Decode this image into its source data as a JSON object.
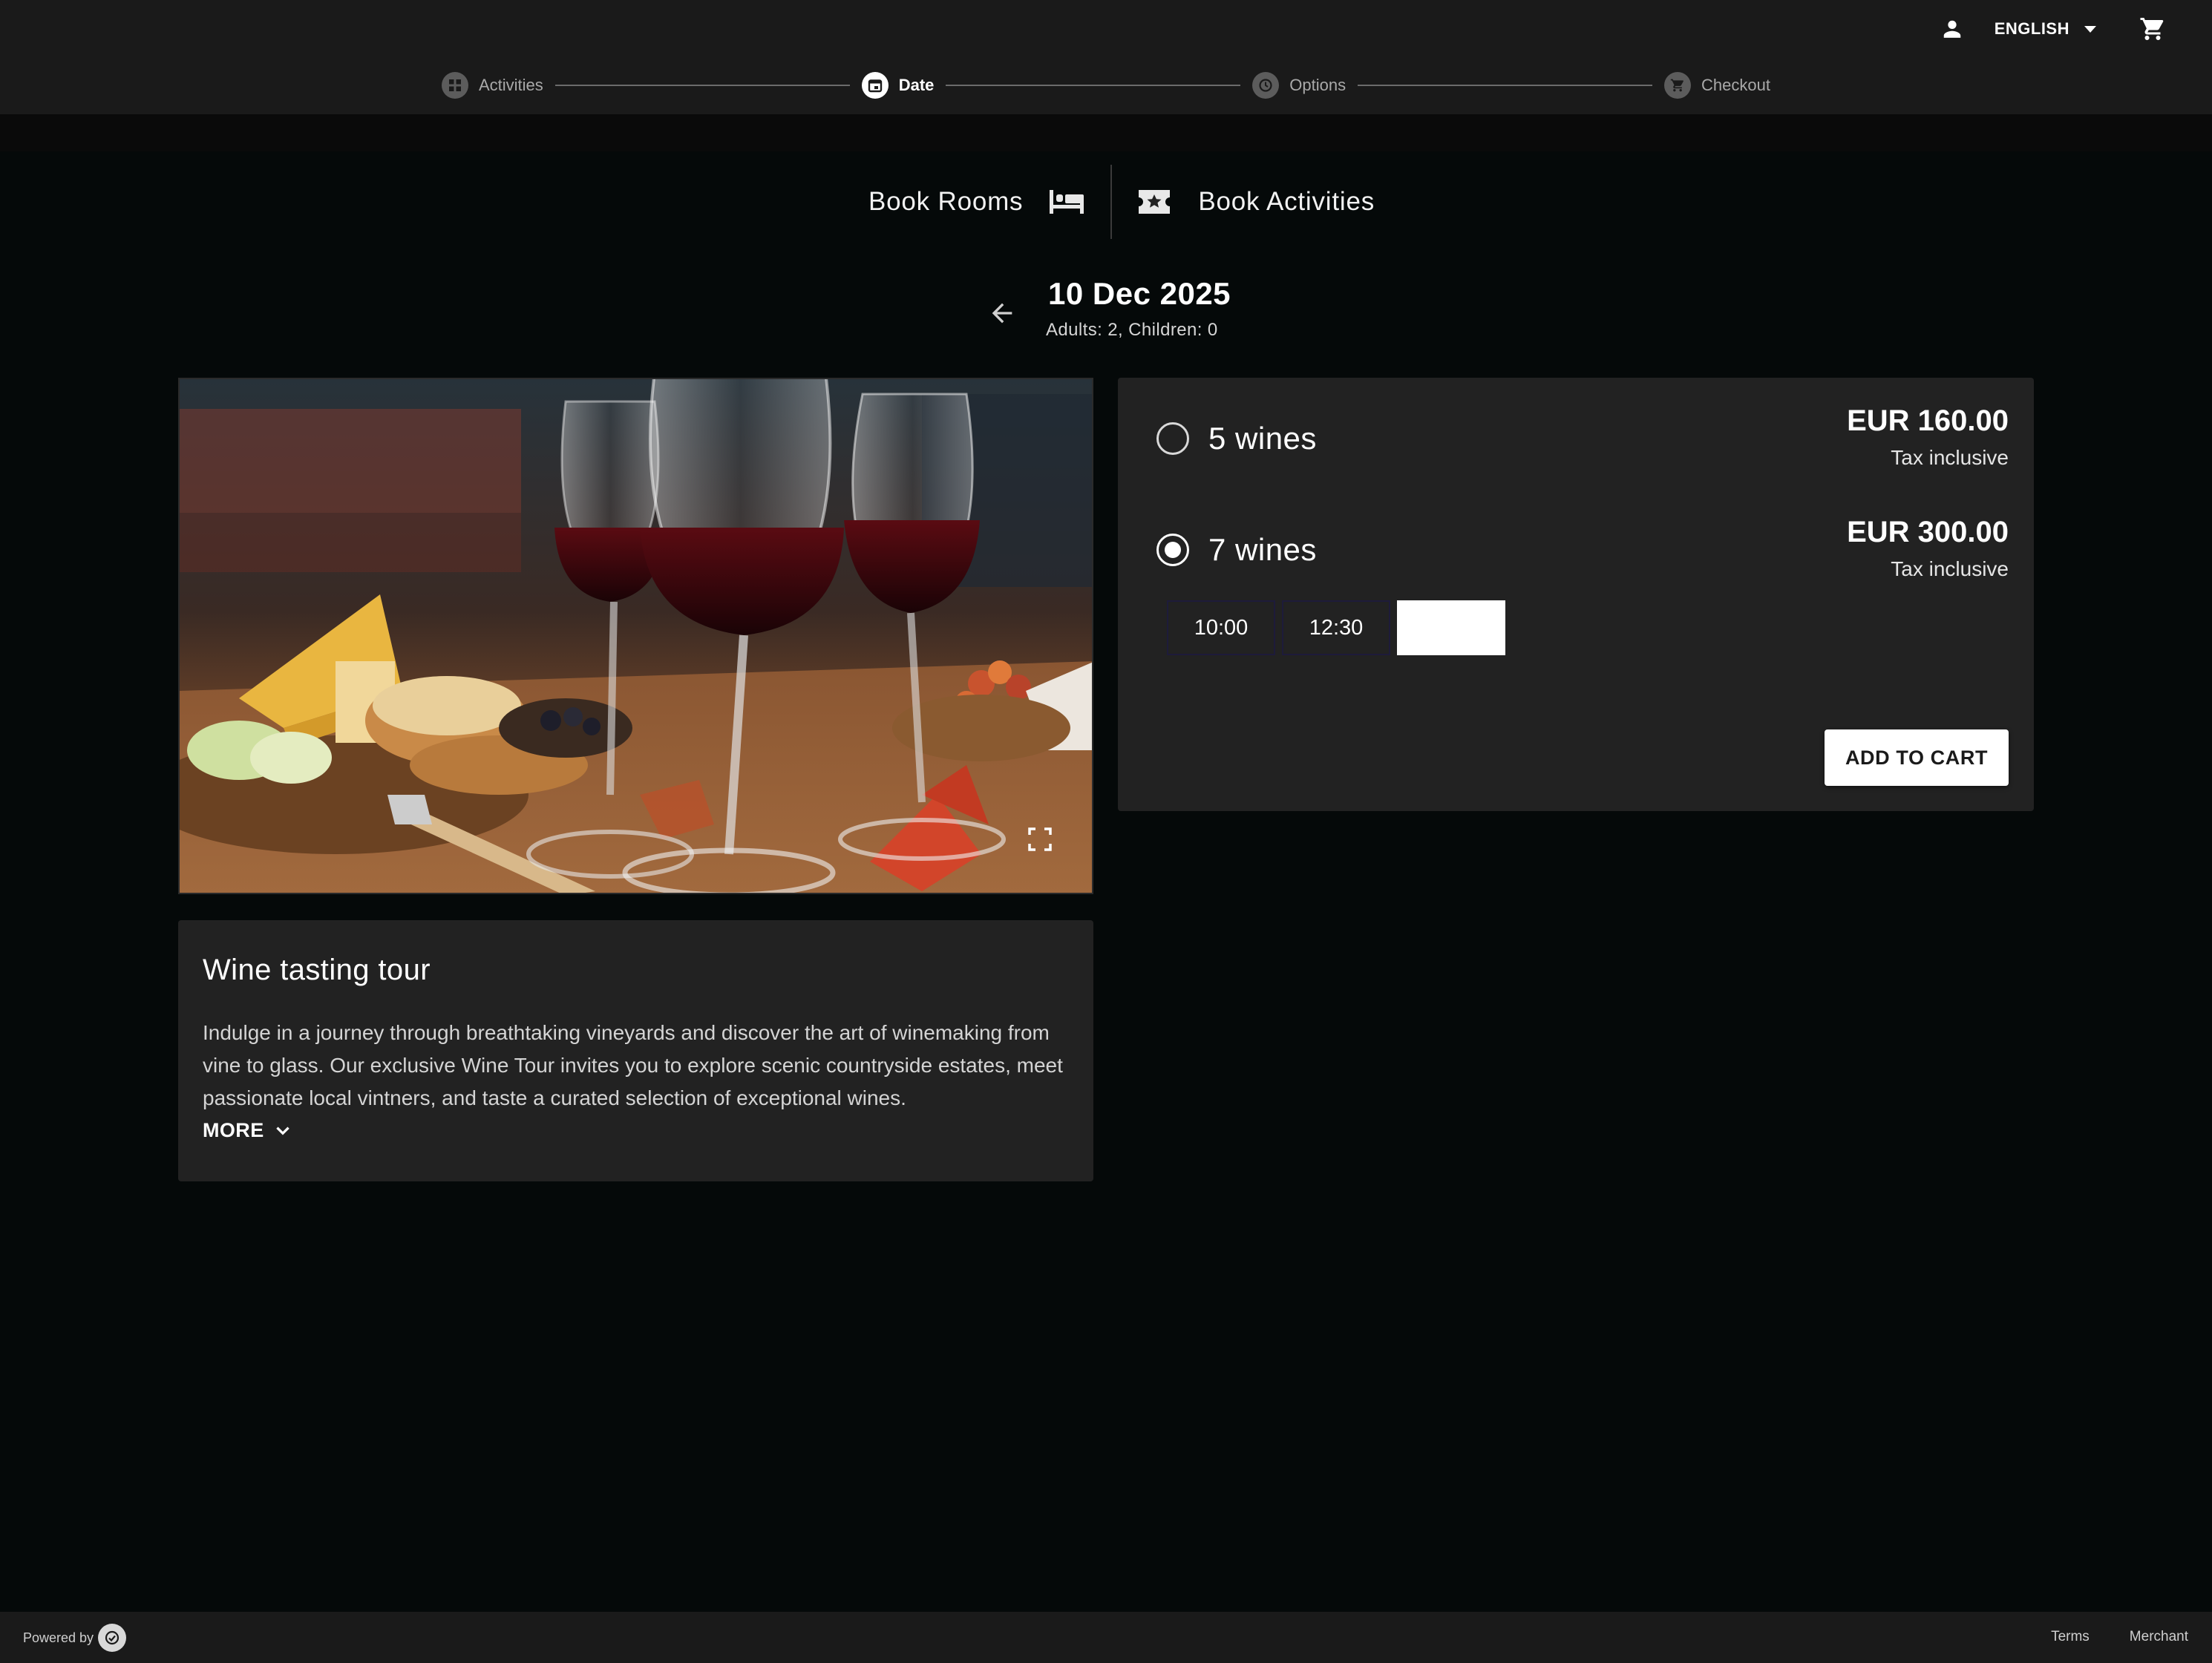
{
  "header": {
    "language": "ENGLISH",
    "user_icon": "person-icon",
    "cart_icon": "shopping-cart-icon"
  },
  "stepper": {
    "steps": [
      {
        "label": "Activities",
        "icon": "grid-icon",
        "active": false
      },
      {
        "label": "Date",
        "icon": "calendar-icon",
        "active": true
      },
      {
        "label": "Options",
        "icon": "clock-icon",
        "active": false
      },
      {
        "label": "Checkout",
        "icon": "cart-icon",
        "active": false
      }
    ]
  },
  "booking": {
    "rooms_label": "Book Rooms",
    "activities_label": "Book Activities"
  },
  "date": {
    "title": "10 Dec 2025",
    "guests": "Adults: 2, Children: 0"
  },
  "activity": {
    "title": "Wine tasting tour",
    "description": "Indulge in a journey through breathtaking vineyards and discover the art of winemaking from vine to glass. Our exclusive Wine Tour invites you to explore scenic countryside estates, meet passionate local vintners, and taste a curated selection of exceptional wines.",
    "more_label": "MORE"
  },
  "options": {
    "items": [
      {
        "name": "5 wines",
        "price": "EUR 160.00",
        "tax": "Tax inclusive",
        "selected": false
      },
      {
        "name": "7 wines",
        "price": "EUR 300.00",
        "tax": "Tax inclusive",
        "selected": true
      }
    ],
    "time_slots": [
      "10:00",
      "12:30",
      ""
    ],
    "add_to_cart": "ADD TO CART"
  },
  "footer": {
    "powered_by": "Powered by",
    "terms": "Terms",
    "merchant": "Merchant"
  },
  "colors": {
    "background": "#050909",
    "bar": "#1a1a1a",
    "card": "#222222",
    "accent": "#ffffff"
  }
}
